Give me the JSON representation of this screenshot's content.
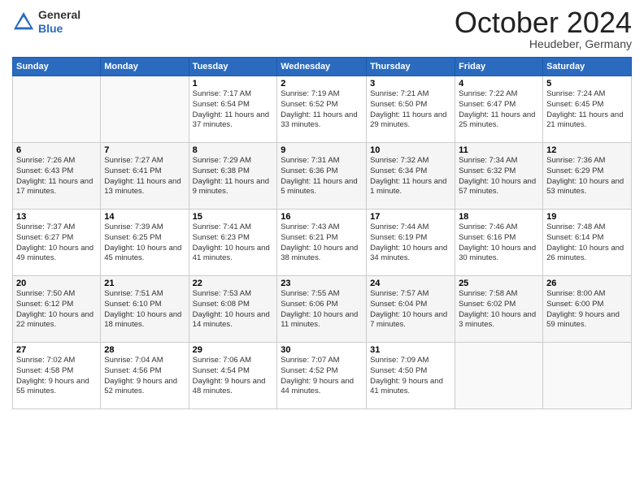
{
  "logo": {
    "general": "General",
    "blue": "Blue"
  },
  "header": {
    "month": "October 2024",
    "location": "Heudeber, Germany"
  },
  "weekdays": [
    "Sunday",
    "Monday",
    "Tuesday",
    "Wednesday",
    "Thursday",
    "Friday",
    "Saturday"
  ],
  "weeks": [
    [
      {
        "day": "",
        "sunrise": "",
        "sunset": "",
        "daylight": ""
      },
      {
        "day": "",
        "sunrise": "",
        "sunset": "",
        "daylight": ""
      },
      {
        "day": "1",
        "sunrise": "Sunrise: 7:17 AM",
        "sunset": "Sunset: 6:54 PM",
        "daylight": "Daylight: 11 hours and 37 minutes."
      },
      {
        "day": "2",
        "sunrise": "Sunrise: 7:19 AM",
        "sunset": "Sunset: 6:52 PM",
        "daylight": "Daylight: 11 hours and 33 minutes."
      },
      {
        "day": "3",
        "sunrise": "Sunrise: 7:21 AM",
        "sunset": "Sunset: 6:50 PM",
        "daylight": "Daylight: 11 hours and 29 minutes."
      },
      {
        "day": "4",
        "sunrise": "Sunrise: 7:22 AM",
        "sunset": "Sunset: 6:47 PM",
        "daylight": "Daylight: 11 hours and 25 minutes."
      },
      {
        "day": "5",
        "sunrise": "Sunrise: 7:24 AM",
        "sunset": "Sunset: 6:45 PM",
        "daylight": "Daylight: 11 hours and 21 minutes."
      }
    ],
    [
      {
        "day": "6",
        "sunrise": "Sunrise: 7:26 AM",
        "sunset": "Sunset: 6:43 PM",
        "daylight": "Daylight: 11 hours and 17 minutes."
      },
      {
        "day": "7",
        "sunrise": "Sunrise: 7:27 AM",
        "sunset": "Sunset: 6:41 PM",
        "daylight": "Daylight: 11 hours and 13 minutes."
      },
      {
        "day": "8",
        "sunrise": "Sunrise: 7:29 AM",
        "sunset": "Sunset: 6:38 PM",
        "daylight": "Daylight: 11 hours and 9 minutes."
      },
      {
        "day": "9",
        "sunrise": "Sunrise: 7:31 AM",
        "sunset": "Sunset: 6:36 PM",
        "daylight": "Daylight: 11 hours and 5 minutes."
      },
      {
        "day": "10",
        "sunrise": "Sunrise: 7:32 AM",
        "sunset": "Sunset: 6:34 PM",
        "daylight": "Daylight: 11 hours and 1 minute."
      },
      {
        "day": "11",
        "sunrise": "Sunrise: 7:34 AM",
        "sunset": "Sunset: 6:32 PM",
        "daylight": "Daylight: 10 hours and 57 minutes."
      },
      {
        "day": "12",
        "sunrise": "Sunrise: 7:36 AM",
        "sunset": "Sunset: 6:29 PM",
        "daylight": "Daylight: 10 hours and 53 minutes."
      }
    ],
    [
      {
        "day": "13",
        "sunrise": "Sunrise: 7:37 AM",
        "sunset": "Sunset: 6:27 PM",
        "daylight": "Daylight: 10 hours and 49 minutes."
      },
      {
        "day": "14",
        "sunrise": "Sunrise: 7:39 AM",
        "sunset": "Sunset: 6:25 PM",
        "daylight": "Daylight: 10 hours and 45 minutes."
      },
      {
        "day": "15",
        "sunrise": "Sunrise: 7:41 AM",
        "sunset": "Sunset: 6:23 PM",
        "daylight": "Daylight: 10 hours and 41 minutes."
      },
      {
        "day": "16",
        "sunrise": "Sunrise: 7:43 AM",
        "sunset": "Sunset: 6:21 PM",
        "daylight": "Daylight: 10 hours and 38 minutes."
      },
      {
        "day": "17",
        "sunrise": "Sunrise: 7:44 AM",
        "sunset": "Sunset: 6:19 PM",
        "daylight": "Daylight: 10 hours and 34 minutes."
      },
      {
        "day": "18",
        "sunrise": "Sunrise: 7:46 AM",
        "sunset": "Sunset: 6:16 PM",
        "daylight": "Daylight: 10 hours and 30 minutes."
      },
      {
        "day": "19",
        "sunrise": "Sunrise: 7:48 AM",
        "sunset": "Sunset: 6:14 PM",
        "daylight": "Daylight: 10 hours and 26 minutes."
      }
    ],
    [
      {
        "day": "20",
        "sunrise": "Sunrise: 7:50 AM",
        "sunset": "Sunset: 6:12 PM",
        "daylight": "Daylight: 10 hours and 22 minutes."
      },
      {
        "day": "21",
        "sunrise": "Sunrise: 7:51 AM",
        "sunset": "Sunset: 6:10 PM",
        "daylight": "Daylight: 10 hours and 18 minutes."
      },
      {
        "day": "22",
        "sunrise": "Sunrise: 7:53 AM",
        "sunset": "Sunset: 6:08 PM",
        "daylight": "Daylight: 10 hours and 14 minutes."
      },
      {
        "day": "23",
        "sunrise": "Sunrise: 7:55 AM",
        "sunset": "Sunset: 6:06 PM",
        "daylight": "Daylight: 10 hours and 11 minutes."
      },
      {
        "day": "24",
        "sunrise": "Sunrise: 7:57 AM",
        "sunset": "Sunset: 6:04 PM",
        "daylight": "Daylight: 10 hours and 7 minutes."
      },
      {
        "day": "25",
        "sunrise": "Sunrise: 7:58 AM",
        "sunset": "Sunset: 6:02 PM",
        "daylight": "Daylight: 10 hours and 3 minutes."
      },
      {
        "day": "26",
        "sunrise": "Sunrise: 8:00 AM",
        "sunset": "Sunset: 6:00 PM",
        "daylight": "Daylight: 9 hours and 59 minutes."
      }
    ],
    [
      {
        "day": "27",
        "sunrise": "Sunrise: 7:02 AM",
        "sunset": "Sunset: 4:58 PM",
        "daylight": "Daylight: 9 hours and 55 minutes."
      },
      {
        "day": "28",
        "sunrise": "Sunrise: 7:04 AM",
        "sunset": "Sunset: 4:56 PM",
        "daylight": "Daylight: 9 hours and 52 minutes."
      },
      {
        "day": "29",
        "sunrise": "Sunrise: 7:06 AM",
        "sunset": "Sunset: 4:54 PM",
        "daylight": "Daylight: 9 hours and 48 minutes."
      },
      {
        "day": "30",
        "sunrise": "Sunrise: 7:07 AM",
        "sunset": "Sunset: 4:52 PM",
        "daylight": "Daylight: 9 hours and 44 minutes."
      },
      {
        "day": "31",
        "sunrise": "Sunrise: 7:09 AM",
        "sunset": "Sunset: 4:50 PM",
        "daylight": "Daylight: 9 hours and 41 minutes."
      },
      {
        "day": "",
        "sunrise": "",
        "sunset": "",
        "daylight": ""
      },
      {
        "day": "",
        "sunrise": "",
        "sunset": "",
        "daylight": ""
      }
    ]
  ]
}
